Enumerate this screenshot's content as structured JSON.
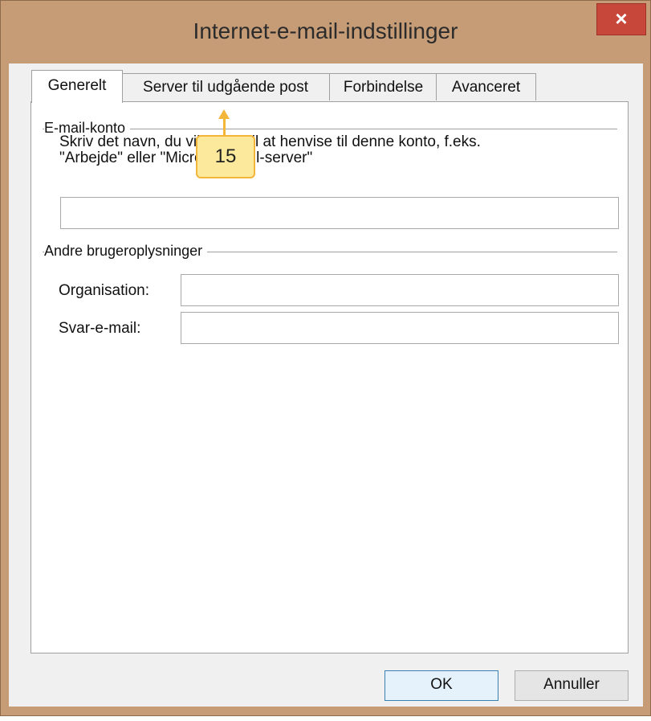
{
  "window": {
    "title": "Internet-e-mail-indstillinger",
    "close_glyph": "×"
  },
  "tabs": [
    {
      "label": "Generelt",
      "active": true
    },
    {
      "label": "Server til udgående post",
      "active": false
    },
    {
      "label": "Forbindelse",
      "active": false
    },
    {
      "label": "Avanceret",
      "active": false
    }
  ],
  "email_account": {
    "group_label": "E-mail-konto",
    "description_line1": "Skriv det navn, du vil bruge til at henvise til denne konto, f.eks.",
    "description_line2": "\"Arbejde\" eller \"Microsoft Mail-server\"",
    "account_name_value": ""
  },
  "user_info": {
    "group_label": "Andre brugeroplysninger",
    "organisation_label": "Organisation:",
    "organisation_value": "",
    "reply_email_label": "Svar-e-mail:",
    "reply_email_value": ""
  },
  "buttons": {
    "ok": "OK",
    "cancel": "Annuller"
  },
  "annotation": {
    "number": "15",
    "color": "#f3b53a",
    "fill": "#fde99b"
  }
}
